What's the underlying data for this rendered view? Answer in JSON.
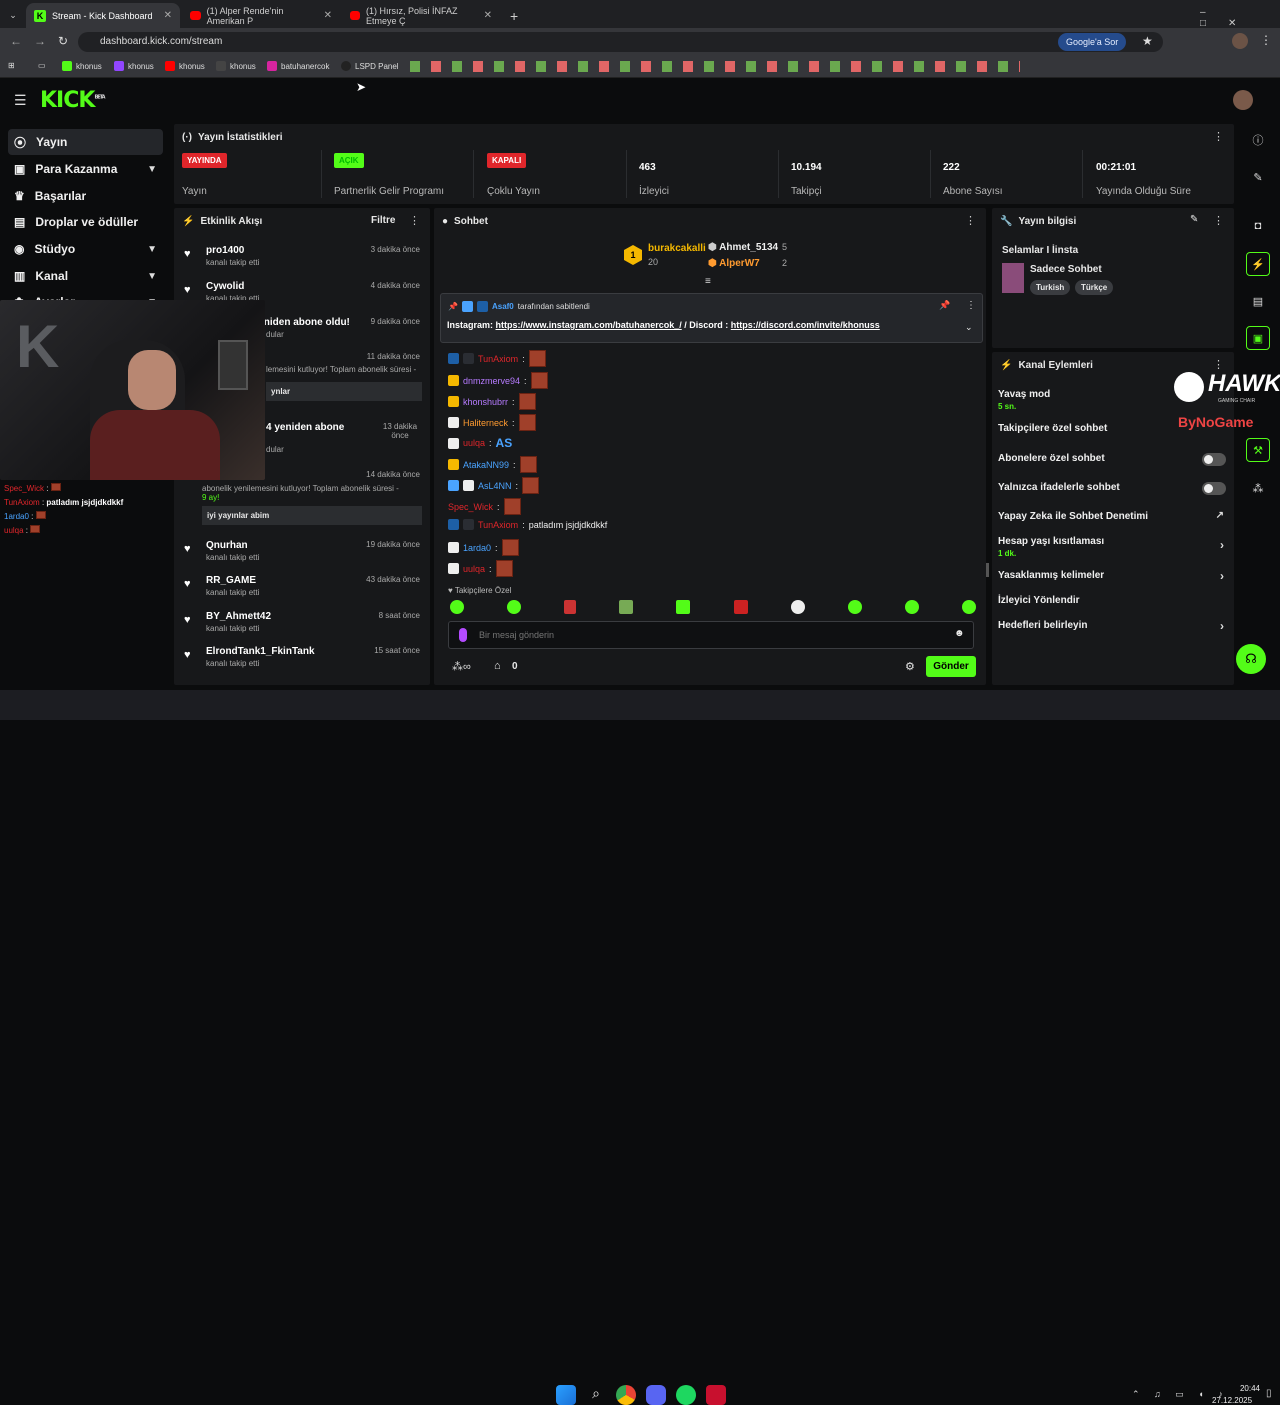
{
  "browser": {
    "tabs": [
      {
        "title": "Stream - Kick Dashboard",
        "active": true
      },
      {
        "title": "(1) Alper Rende'nin Amerikan P"
      },
      {
        "title": "(1) Hırsız, Polisi İNFAZ Etmeye Ç"
      }
    ],
    "url": "dashboard.kick.com/stream",
    "google_btn": "Google'a Sor",
    "bookmarks": [
      "khonus",
      "khonus",
      "khonus",
      "khonus",
      "batuhanercok",
      "LSPD Panel"
    ]
  },
  "kick": {
    "logo": "KICK",
    "beta": "BETA"
  },
  "sidebar": {
    "items": [
      {
        "label": "Yayın"
      },
      {
        "label": "Para Kazanma"
      },
      {
        "label": "Başarılar"
      },
      {
        "label": "Droplar ve ödüller"
      },
      {
        "label": "Stüdyo"
      },
      {
        "label": "Kanal"
      },
      {
        "label": "Ayarlar"
      }
    ]
  },
  "stats": {
    "title": "Yayın İstatistikleri",
    "items": [
      {
        "badge": "YAYINDA",
        "label": "Yayın",
        "color": "#e0262b"
      },
      {
        "badge": "AÇIK",
        "label": "Partnerlik Gelir Programı",
        "color": "#53fc18"
      },
      {
        "badge": "KAPALI",
        "label": "Çoklu Yayın",
        "color": "#e0262b"
      },
      {
        "value": "463",
        "label": "İzleyici"
      },
      {
        "value": "10.194",
        "label": "Takipçi"
      },
      {
        "value": "222",
        "label": "Abone Sayısı"
      },
      {
        "value": "00:21:01",
        "label": "Yayında Olduğu Süre"
      }
    ]
  },
  "activity": {
    "title": "Etkinlik Akışı",
    "filter": "Filtre",
    "items": [
      {
        "name": "pro1400",
        "sub": "kanalı takip etti",
        "time": "3 dakika önce"
      },
      {
        "name": "Cywolid",
        "sub": "kanalı takip etti",
        "time": "4 dakika önce"
      },
      {
        "name": "OnurSLR yeniden abone oldu!",
        "sub": "dular",
        "time": "9 dakika önce"
      },
      {
        "name": "",
        "sub": "lemesini kutluyor! Toplam abonelik süresi -",
        "time": "11 dakika önce",
        "msg": "ynlar"
      },
      {
        "name": "4 yeniden abone",
        "sub": "dular",
        "time": "13 dakika önce"
      },
      {
        "name": "",
        "sub": "abonelik yenilemesini kutluyor! Toplam abonelik süresi -",
        "sub2": "9 ay!",
        "time": "14 dakika önce",
        "msg": "iyi yayınlar abim"
      },
      {
        "name": "Qnurhan",
        "sub": "kanalı takip etti",
        "time": "19 dakika önce"
      },
      {
        "name": "RR_GAME",
        "sub": "kanalı takip etti",
        "time": "43 dakika önce"
      },
      {
        "name": "BY_Ahmett42",
        "sub": "kanalı takip etti",
        "time": "8 saat önce"
      },
      {
        "name": "ElrondTank1_FkinTank",
        "sub": "kanalı takip etti",
        "time": "15 saat önce"
      }
    ]
  },
  "chat": {
    "title": "Sohbet",
    "top": [
      {
        "name": "burakcakalli",
        "count": "20",
        "rank": "1"
      },
      {
        "name": "Ahmet_5134",
        "count": "5"
      },
      {
        "name": "AlperW7",
        "count": "2"
      }
    ],
    "pinned_by_user": "Asaf0",
    "pinned_by": "tarafından sabitlendi",
    "pinned_label": "Instagram:",
    "pinned_link1": "https://www.instagram.com/batuhanercok_/",
    "pinned_mid": "/ Discord :",
    "pinned_link2": "https://discord.com/invite/khonuss",
    "messages": [
      {
        "user": "TunAxiom",
        "color": "#e0262b"
      },
      {
        "user": "dnmzmerve94",
        "color": "#b67bff"
      },
      {
        "user": "khonshubrr",
        "color": "#b67bff"
      },
      {
        "user": "Haliterneck",
        "color": "#ff9b30"
      },
      {
        "user": "uulqa",
        "color": "#e0262b",
        "text": "AS"
      },
      {
        "user": "AtakaNN99",
        "color": "#4aa3ff"
      },
      {
        "user": "AsL4NN",
        "color": "#4aa3ff"
      },
      {
        "user": "Spec_Wick",
        "color": "#e0262b"
      },
      {
        "user": "TunAxiom",
        "color": "#e0262b",
        "text": "patladım jsjdjdkdkkf"
      },
      {
        "user": "1arda0",
        "color": "#4aa3ff"
      },
      {
        "user": "uulqa",
        "color": "#e0262b"
      }
    ],
    "followers_only": "Takipçilere Özel",
    "input_placeholder": "Bir mesaj gönderin",
    "points": "0",
    "send": "Gönder"
  },
  "webcam_chat": [
    {
      "user": "Spec_Wick",
      "color": "#e0262b"
    },
    {
      "user": "TunAxiom",
      "color": "#e0262b",
      "text": "patladım jsjdjdkdkkf"
    },
    {
      "user": "1arda0",
      "color": "#4aa3ff"
    },
    {
      "user": "uulqa",
      "color": "#e0262b"
    }
  ],
  "stream_info": {
    "title": "Yayın bilgisi",
    "stream_title": "Selamlar I İinsta",
    "category": "Sadece Sohbet",
    "tags": [
      "Turkish",
      "Türkçe"
    ]
  },
  "channel_actions": {
    "title": "Kanal Eylemleri",
    "items": [
      {
        "label": "Yavaş mod",
        "sub": "5 sn."
      },
      {
        "label": "Takipçilere özel sohbet"
      },
      {
        "label": "Abonelere özel sohbet"
      },
      {
        "label": "Yalnızca ifadelerle sohbet"
      },
      {
        "label": "Yapay Zeka ile Sohbet Denetimi"
      },
      {
        "label": "Hesap yaşı kısıtlaması",
        "sub": "1 dk."
      },
      {
        "label": "Yasaklanmış kelimeler"
      },
      {
        "label": "İzleyici Yönlendir"
      },
      {
        "label": "Hedefleri belirleyin"
      }
    ]
  },
  "overlay": {
    "brand": "HAWK",
    "brand_sub": "GAMING CHAIR",
    "sponsor": "ByNoGame"
  },
  "taskbar": {
    "time": "20:44",
    "date": "27.12.2025"
  }
}
